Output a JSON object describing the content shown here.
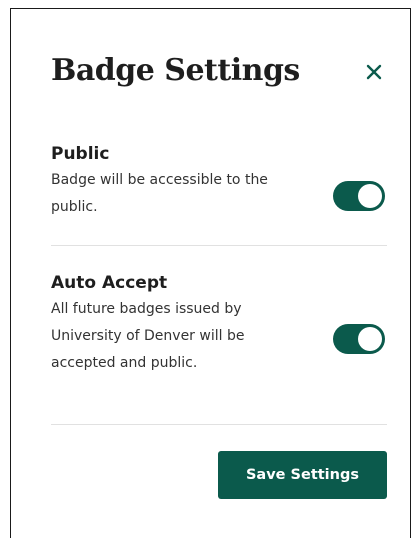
{
  "dialog": {
    "title": "Badge Settings",
    "close_icon": "close-icon"
  },
  "settings": [
    {
      "label": "Public",
      "description": "Badge will be accessible to the public.",
      "enabled": true
    },
    {
      "label": "Auto Accept",
      "description": "All future badges issued by University of Denver will be accepted and public.",
      "enabled": true
    }
  ],
  "footer": {
    "save_label": "Save Settings"
  },
  "colors": {
    "accent": "#0b5a4c",
    "text": "#1e1e1e",
    "divider": "#e1e1e1"
  }
}
